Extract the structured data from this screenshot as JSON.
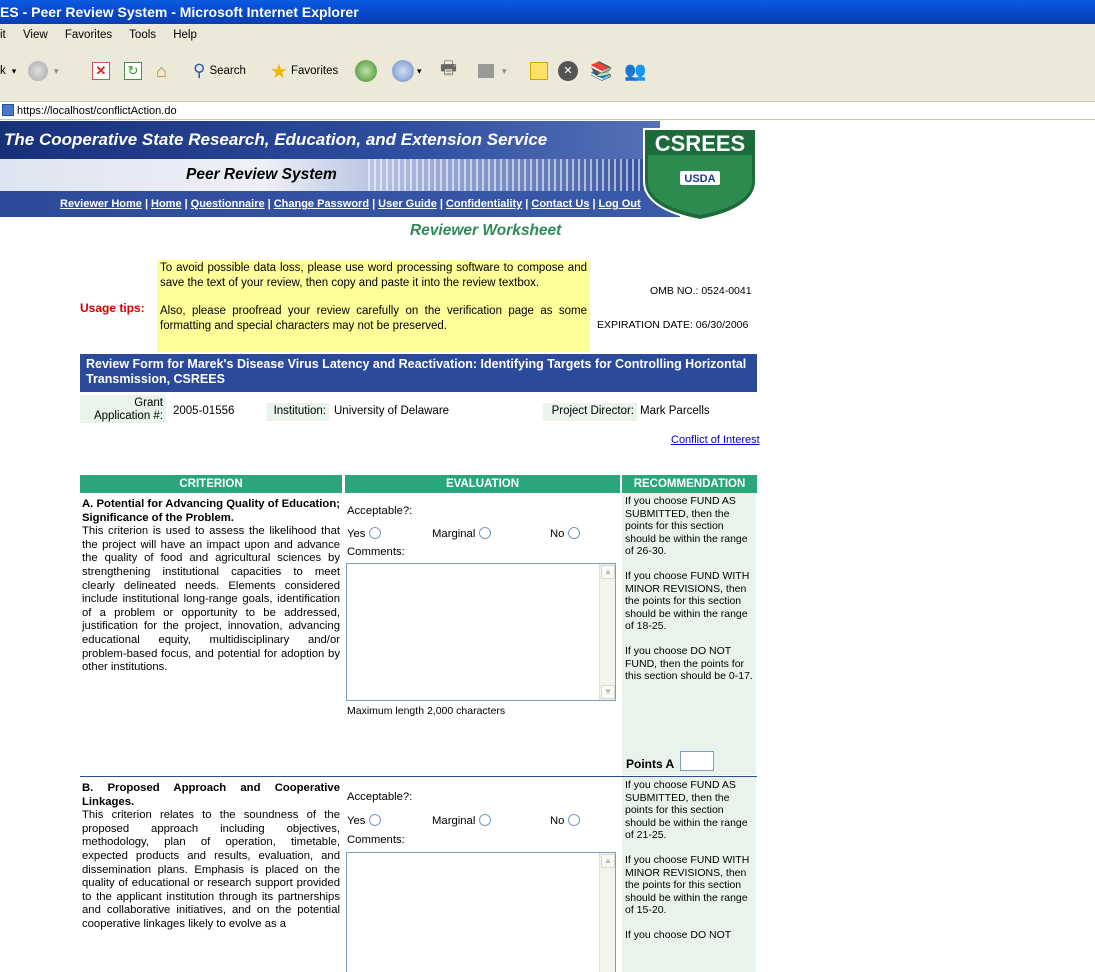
{
  "window": {
    "title": "ES - Peer Review System - Microsoft Internet Explorer"
  },
  "menu": [
    "it",
    "View",
    "Favorites",
    "Tools",
    "Help"
  ],
  "toolbar": {
    "back": "k",
    "search": "Search",
    "favorites": "Favorites"
  },
  "address": {
    "url": "https://localhost/conflictAction.do"
  },
  "banner": {
    "agency": "The Cooperative State Research, Education, and Extension Service",
    "system": "Peer Review System",
    "logo_text": "CSREES",
    "logo_sub": "USDA"
  },
  "nav": [
    "Reviewer Home",
    "Home",
    "Questionnaire",
    "Change Password",
    "User Guide",
    "Confidentiality",
    "Contact Us",
    "Log Out"
  ],
  "page_title": "Reviewer Worksheet",
  "tips": {
    "label": "Usage tips:",
    "para1": "To avoid possible data loss, please use word processing software to compose and save the text of your review, then copy and paste it into the review textbox.",
    "para2": "Also, please proofread your review carefully on the verification page as some formatting and special characters may not be preserved."
  },
  "omb": "OMB NO.: 0524-0041",
  "expiration": "EXPIRATION DATE: 06/30/2006",
  "form_title": "Review Form for Marek's Disease Virus Latency and Reactivation: Identifying Targets for Controlling Horizontal Transmission, CSREES",
  "info": {
    "grant_label": "Grant Application #:",
    "grant_value": "2005-01556",
    "institution_label": "Institution:",
    "institution_value": "University of Delaware",
    "pd_label": "Project Director:",
    "pd_value": "Mark Parcells",
    "coi_link": "Conflict of Interest"
  },
  "columns": {
    "criterion": "CRITERION",
    "evaluation": "EVALUATION",
    "recommendation": "RECOMMENDATION"
  },
  "eval_labels": {
    "acceptable": "Acceptable?:",
    "yes": "Yes",
    "marginal": "Marginal",
    "no": "No",
    "comments": "Comments:",
    "maxlen": "Maximum length 2,000 characters"
  },
  "sections": [
    {
      "heading": "A. Potential for Advancing Quality of Education; Significance of the Problem.",
      "body": "This criterion is used to assess the likelihood that the project will have an impact upon and advance the quality of food and agricultural sciences by strengthening institutional capacities to meet clearly delineated needs. Elements considered include institutional long-range goals, identification of a problem or opportunity to be addressed, justification for the project, innovation, advancing educational equity, multidisciplinary and/or problem-based focus, and potential for adoption by other institutions.",
      "rec1": "If you choose FUND AS SUBMITTED, then the points for this section should be within the range of 26-30.",
      "rec2": "If you choose FUND WITH MINOR REVISIONS, then the points for this section should be within the range of 18-25.",
      "rec3": "If you choose DO NOT FUND, then the points for this section should be 0-17.",
      "points_label": "Points A"
    },
    {
      "heading": "B. Proposed Approach and Cooperative Linkages.",
      "body": "This criterion relates to the soundness of the proposed approach including objectives, methodology, plan of operation, timetable, expected products and results, evaluation, and dissemination plans. Emphasis is placed on the quality of educational or research support provided to the applicant institution through its partnerships and collaborative initiatives, and on the potential cooperative linkages likely to evolve as a",
      "rec1": "If you choose FUND AS SUBMITTED, then the points for this section should be within the range of 21-25.",
      "rec2": "If you choose FUND WITH MINOR REVISIONS, then the points for this section should be within the range of 15-20.",
      "rec3": "If you choose DO NOT"
    }
  ],
  "colors": {
    "navy": "#2c4a9a",
    "green_header": "#2ba67a",
    "tips_bg": "#ffff99",
    "rec_bg": "#e8f3ec"
  }
}
